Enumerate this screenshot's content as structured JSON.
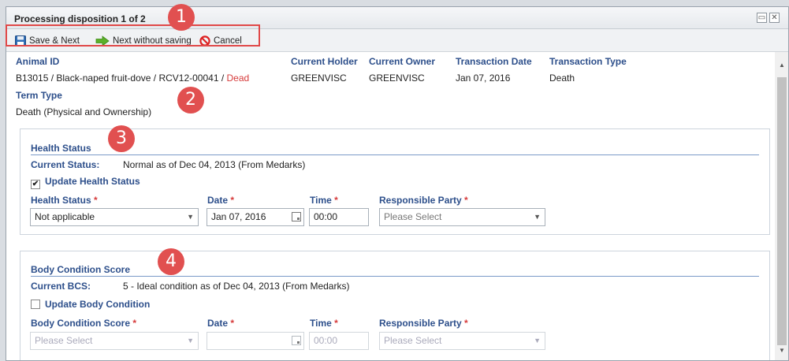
{
  "dialog": {
    "title": "Processing disposition 1 of 2",
    "restore_glyph": "▭",
    "close_glyph": "✕"
  },
  "toolbar": {
    "save_next": "Save & Next",
    "next_without_saving": "Next without saving",
    "cancel": "Cancel"
  },
  "badges": [
    "1",
    "2",
    "3",
    "4"
  ],
  "record": {
    "animal_id_label": "Animal ID",
    "animal_id_value": "B13015 / Black-naped fruit-dove / RCV12-00041 / ",
    "animal_status": "Dead",
    "current_holder_label": "Current Holder",
    "current_holder_value": "GREENVISC",
    "current_owner_label": "Current Owner",
    "current_owner_value": "GREENVISC",
    "transaction_date_label": "Transaction Date",
    "transaction_date_value": "Jan 07, 2016",
    "transaction_type_label": "Transaction Type",
    "transaction_type_value": "Death",
    "term_type_label": "Term Type",
    "term_type_value": "Death (Physical and Ownership)"
  },
  "health": {
    "section_title": "Health Status",
    "current_label": "Current Status:",
    "current_value": "Normal as of Dec 04, 2013 (From Medarks)",
    "update_label": "Update Health Status",
    "update_checked": true,
    "status_label": "Health Status",
    "status_value": "Not applicable",
    "date_label": "Date",
    "date_value": "Jan 07, 2016",
    "time_label": "Time",
    "time_value": "00:00",
    "party_label": "Responsible Party",
    "party_placeholder": "Please Select"
  },
  "bcs": {
    "section_title": "Body Condition Score",
    "current_label": "Current BCS:",
    "current_value": "5 - Ideal condition as of Dec 04, 2013 (From Medarks)",
    "update_label": "Update Body Condition",
    "update_checked": false,
    "score_label": "Body Condition Score",
    "score_placeholder": "Please Select",
    "date_label": "Date",
    "date_value": "",
    "time_label": "Time",
    "time_value": "00:00",
    "party_label": "Responsible Party",
    "party_placeholder": "Please Select"
  },
  "required_mark": "*",
  "colors": {
    "label_blue": "#2d4f8b",
    "required_red": "#d63a3a",
    "highlight_red": "#e15050"
  }
}
